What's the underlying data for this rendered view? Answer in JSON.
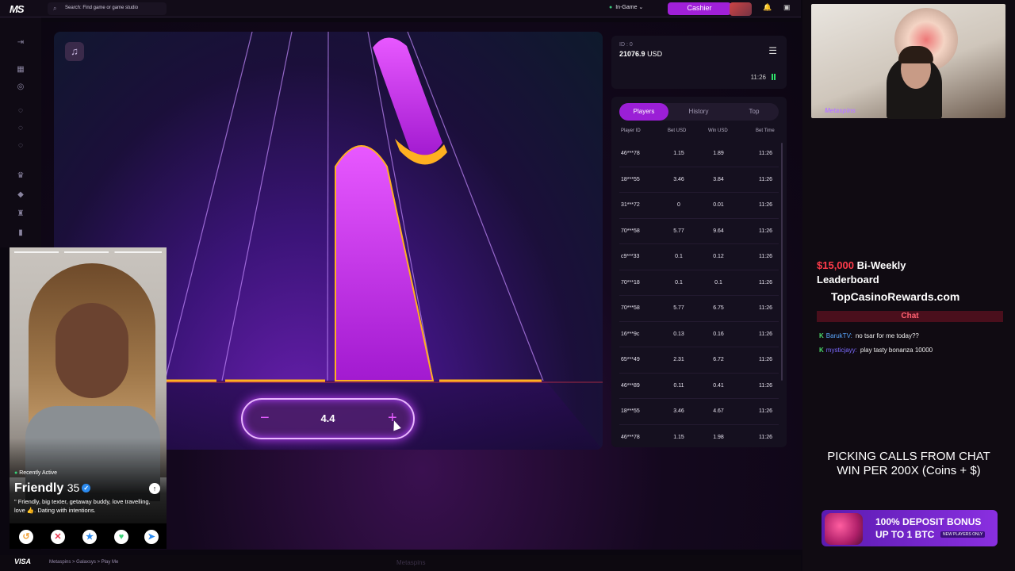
{
  "topbar": {
    "search_placeholder": "Search: Find game or game studio",
    "status": "In-Game",
    "cashier": "Cashier"
  },
  "game": {
    "stake_value": "4.4",
    "minus": "−",
    "plus": "+"
  },
  "balance": {
    "id": "ID : 0",
    "amount": "21076.9",
    "currency": "USD",
    "time": "11:26"
  },
  "bets": {
    "tabs": [
      "Players",
      "History",
      "Top"
    ],
    "headers": [
      "Player ID",
      "Bet USD",
      "Win USD",
      "Bet Time"
    ],
    "rows": [
      [
        "46***78",
        "1.15",
        "1.89",
        "11:26"
      ],
      [
        "18***55",
        "3.46",
        "3.84",
        "11:26"
      ],
      [
        "31***72",
        "0",
        "0.01",
        "11:26"
      ],
      [
        "70***58",
        "5.77",
        "9.64",
        "11:26"
      ],
      [
        "c9***33",
        "0.1",
        "0.12",
        "11:26"
      ],
      [
        "70***18",
        "0.1",
        "0.1",
        "11:26"
      ],
      [
        "70***58",
        "5.77",
        "6.75",
        "11:26"
      ],
      [
        "16***9c",
        "0.13",
        "0.16",
        "11:26"
      ],
      [
        "65***49",
        "2.31",
        "6.72",
        "11:26"
      ],
      [
        "46***89",
        "0.11",
        "0.41",
        "11:26"
      ],
      [
        "18***55",
        "3.46",
        "4.67",
        "11:26"
      ],
      [
        "46***78",
        "1.15",
        "1.98",
        "11:26"
      ]
    ]
  },
  "stream": {
    "cam_label": "Metaspins",
    "promo_amount": "$15,000",
    "promo_line1": "Bi-Weekly",
    "promo_line2": "Leaderboard",
    "promo_site": "TopCasinoRewards.com",
    "chat_title": "Chat",
    "chat": [
      {
        "user": "BarukTV:",
        "msg": "no tsar for me today??"
      },
      {
        "user": "mysticjayy:",
        "msg": "play tasty bonanza 10000"
      }
    ],
    "calls_line1": "PICKING CALLS FROM CHAT",
    "calls_line2": "WIN PER 200X (Coins + $)",
    "bonus_line1": "100% DEPOSIT BONUS",
    "bonus_line2": "UP TO 1 BTC",
    "bonus_tag": "NEW PLAYERS ONLY"
  },
  "dating": {
    "status": "Recently Active",
    "name": "Friendly",
    "age": "35",
    "bio": "\" Friendly, big texter, getaway buddy, love travelling, love 👍. Dating with intentions."
  },
  "footer": {
    "card": "VISA",
    "breadcrumb": "Metaspins > Galaxsys > Play Me",
    "brand": "Metaspins"
  },
  "colors": {
    "accent": "#9b1fd6",
    "neon_pink": "#e045ff",
    "gold": "#ffb020",
    "chat_user": "#5ba8ff",
    "promo_red": "#ff3b4a"
  },
  "icons": [
    "search-icon",
    "music-icon",
    "menu-icon",
    "signal-icon",
    "bell-icon",
    "gift-icon",
    "verified-icon",
    "rewind-icon",
    "close-icon",
    "star-icon",
    "heart-icon",
    "send-icon"
  ]
}
